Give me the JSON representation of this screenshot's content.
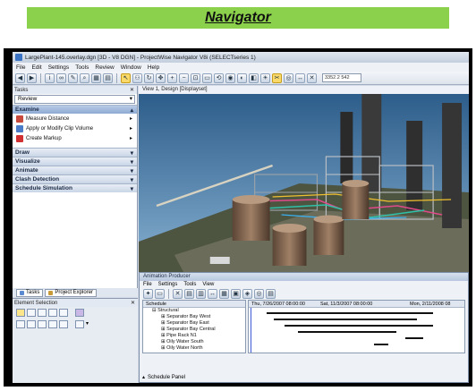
{
  "banner": {
    "title": "Navigator"
  },
  "window": {
    "title": "LargePlant-145.overlay.dgn [3D - V8 DGN] - ProjectWise Navigator V8i (SELECTseries 1)"
  },
  "menu": [
    "File",
    "Edit",
    "Settings",
    "Tools",
    "Review",
    "Window",
    "Help"
  ],
  "toolbar": {
    "coordinate": "3352.2 542"
  },
  "tasks": {
    "header": "Tasks",
    "dropdown": "Review",
    "examine": "Examine",
    "items": [
      "Measure Distance",
      "Apply or Modify Clip Volume",
      "Create Markup"
    ],
    "sections": [
      "Draw",
      "Visualize",
      "Animate",
      "Clash Detection",
      "Schedule Simulation"
    ]
  },
  "bottom_tabs": [
    "Tasks",
    "Project Explorer"
  ],
  "element_selection": {
    "title": "Element Selection"
  },
  "view": {
    "title": "View 1, Design [Displayset]"
  },
  "animation": {
    "title": "Animation Producer",
    "menu": [
      "File",
      "Settings",
      "Tools",
      "View"
    ],
    "schedule_header": "Schedule",
    "schedule_root": "Structural",
    "schedule_items": [
      "Separator Bay West",
      "Separator Bay East",
      "Separator Bay Central",
      "Pipe Rack N1",
      "Oily Water South",
      "Oily Water North"
    ],
    "timeline": [
      "Thu, 7/26/2007 08:00:00",
      "Sat, 11/3/2007 08:00:00",
      "Mon, 2/11/2008 08"
    ],
    "schedule_panel": "Schedule Panel"
  },
  "colors": {
    "banner": "#8bd14b",
    "frame": "#000000",
    "sky": "#78a8d0",
    "ground": "#5a6048"
  }
}
